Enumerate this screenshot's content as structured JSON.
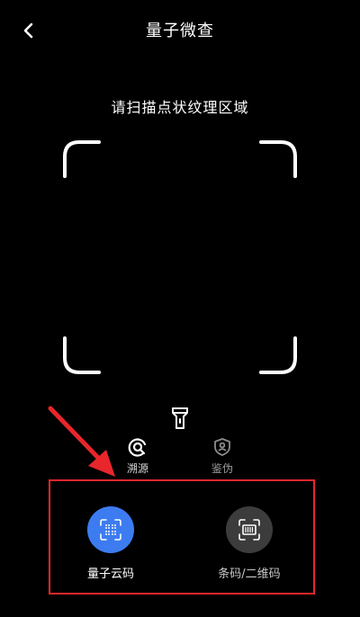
{
  "header": {
    "title": "量子微查",
    "back_icon": "chevron-left-icon"
  },
  "scanner": {
    "hint": "请扫描点状纹理区域",
    "flashlight_icon": "flashlight-icon"
  },
  "mode_tabs": [
    {
      "label": "溯源",
      "icon": "trace-icon",
      "active": true
    },
    {
      "label": "鉴伪",
      "icon": "shield-user-icon",
      "active": false
    }
  ],
  "scan_options": [
    {
      "label": "量子云码",
      "icon": "dot-grid-icon",
      "color": "#3d7cf0",
      "selected": true
    },
    {
      "label": "条码/二维码",
      "icon": "barcode-scan-icon",
      "color": "#3c3c3c",
      "selected": false
    }
  ],
  "annotations": {
    "highlight_color": "#e8262b"
  }
}
